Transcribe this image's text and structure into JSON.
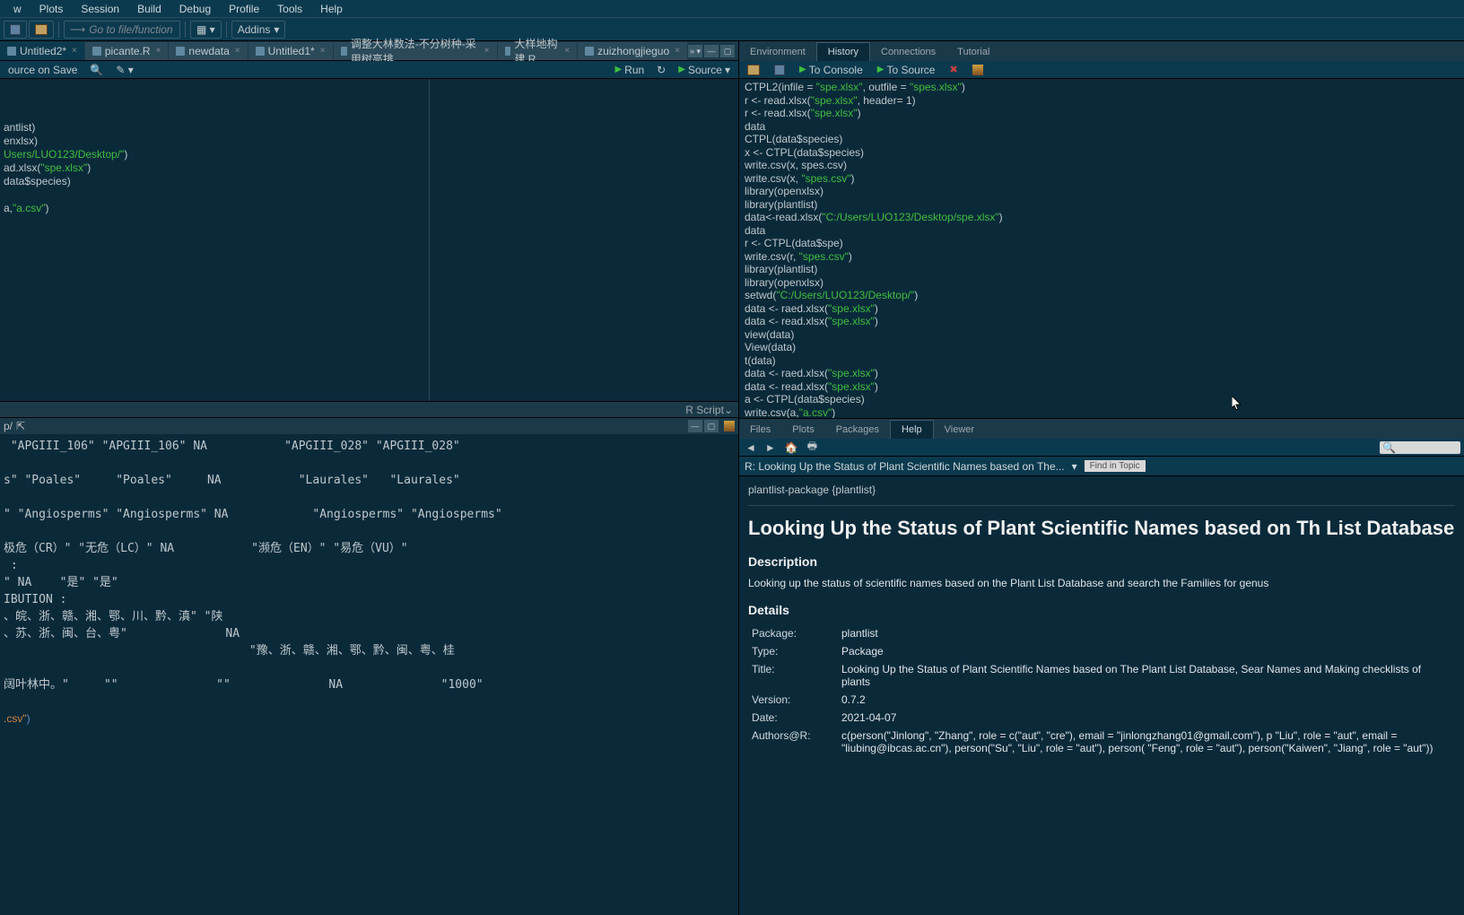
{
  "menu": {
    "items": [
      "w",
      "Plots",
      "Session",
      "Build",
      "Debug",
      "Profile",
      "Tools",
      "Help"
    ]
  },
  "toolbar": {
    "goto": "Go to file/function",
    "addins": "Addins"
  },
  "editor_tabs": [
    {
      "label": "Untitled2*"
    },
    {
      "label": "picante.R"
    },
    {
      "label": "newdata"
    },
    {
      "label": "Untitled1*"
    },
    {
      "label": "调整大林数法-不分树种-采用树高排..."
    },
    {
      "label": "大样地构建.R"
    },
    {
      "label": "zuizhongjieguo"
    }
  ],
  "editor_toolbar": {
    "source_on_save": "ource on Save",
    "run": "Run",
    "source": "Source"
  },
  "editor_lines": [
    {
      "pre": "antlist)",
      "str": ""
    },
    {
      "pre": "enxlsx)",
      "str": ""
    },
    {
      "pre": "Users/LUO123/Desktop/\"",
      "str": "",
      "paren": ")"
    },
    {
      "pre": "ad.xlsx(",
      "str": "\"spe.xlsx\"",
      "paren": ")"
    },
    {
      "pre": "data$species)",
      "str": ""
    },
    {
      "pre": "",
      "str": ""
    },
    {
      "pre": "a,",
      "str": "\"a.csv\"",
      "paren": ")"
    }
  ],
  "editor_status": "R Script",
  "console_path": "p/",
  "console_text_raw": " \"APGIII_106\" \"APGIII_106\" NA           \"APGIII_028\" \"APGIII_028\"\n\ns\" \"Poales\"     \"Poales\"     NA           \"Laurales\"   \"Laurales\"\n\n\" \"Angiosperms\" \"Angiosperms\" NA            \"Angiosperms\" \"Angiosperms\"\n\n极危（CR）\" \"无危（LC）\" NA           \"濒危（EN）\" \"易危（VU）\"\n :\n\" NA    \"是\" \"是\"\nIBUTION :\n、皖、浙、赣、湘、鄂、川、黔、滇\" \"陕\n、苏、浙、闽、台、粤\"              NA\n                                   \"豫、浙、赣、湘、鄂、黔、闽、粤、桂\n\n阔叶林中。\"     \"\"              \"\"              NA              \"1000\"\n\n.csv\")",
  "env_tabs": [
    "Environment",
    "History",
    "Connections",
    "Tutorial"
  ],
  "env_toolbar": {
    "to_console": "To Console",
    "to_source": "To Source"
  },
  "history_lines": [
    "CTPL2(infile = \"spe.xlsx\", outfile = \"spes.xlsx\")",
    "r <- read.xlsx(\"spe.xlsx\", header= 1)",
    "r <- read.xlsx(\"spe.xlsx\")",
    "data",
    "CTPL(data$species)",
    "x <- CTPL(data$species)",
    "write.csv(x, spes.csv)",
    "write.csv(x, \"spes.csv\")",
    "library(openxlsx)",
    "library(plantlist)",
    "data<-read.xlsx(\"C:/Users/LUO123/Desktop/spe.xlsx\")",
    "data",
    "r <- CTPL(data$spe)",
    "write.csv(r, \"spes.csv\")",
    "library(plantlist)",
    "library(openxlsx)",
    "setwd(\"C:/Users/LUO123/Desktop/\")",
    "data <- raed.xlsx(\"spe.xlsx\")",
    "data <- read.xlsx(\"spe.xlsx\")",
    "view(data)",
    "View(data)",
    "t(data)",
    "data <- raed.xlsx(\"spe.xlsx\")",
    "data <- read.xlsx(\"spe.xlsx\")",
    "a <- CTPL(data$species)",
    "write.csv(a,\"a.csv\")"
  ],
  "help_tabs": [
    "Files",
    "Plots",
    "Packages",
    "Help",
    "Viewer"
  ],
  "help": {
    "breadcrumb": "R: Looking Up the Status of Plant Scientific Names based on The...",
    "find": "Find in Topic",
    "topic": "plantlist-package {plantlist}",
    "title": "Looking Up the Status of Plant Scientific Names based on Th List Database",
    "desc_h": "Description",
    "desc_p": "Looking up the status of scientific names based on the Plant List Database and search the Families for genus",
    "details_h": "Details",
    "table": [
      [
        "Package:",
        "plantlist"
      ],
      [
        "Type:",
        "Package"
      ],
      [
        "Title:",
        "Looking Up the Status of Plant Scientific Names based on The Plant List Database, Sear Names and Making checklists of plants"
      ],
      [
        "Version:",
        "0.7.2"
      ],
      [
        "Date:",
        "2021-04-07"
      ],
      [
        "Authors@R:",
        "c(person(\"Jinlong\", \"Zhang\", role = c(\"aut\", \"cre\"), email = \"jinlongzhang01@gmail.com\"), p \"Liu\", role = \"aut\", email = \"liubing@ibcas.ac.cn\"), person(\"Su\", \"Liu\", role = \"aut\"), person( \"Feng\", role = \"aut\"), person(\"Kaiwen\", \"Jiang\", role = \"aut\"))"
      ]
    ]
  }
}
